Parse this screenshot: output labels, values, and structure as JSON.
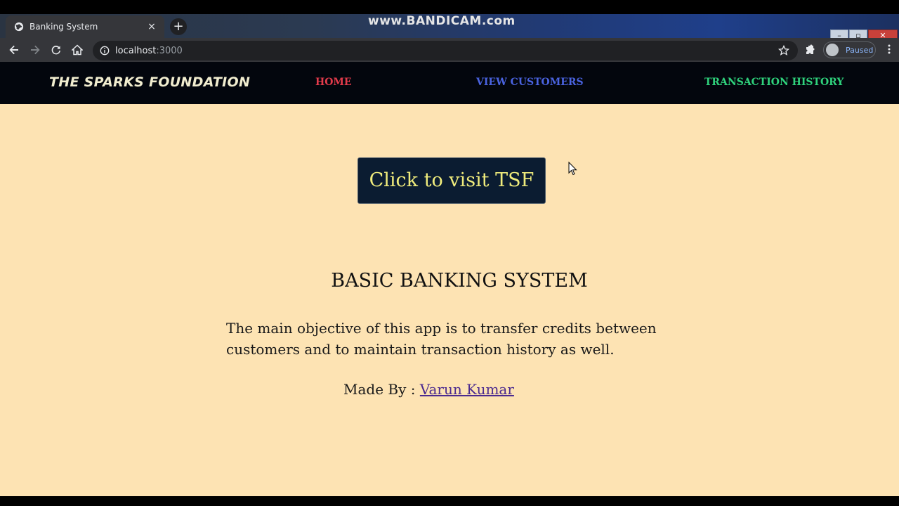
{
  "browser": {
    "tab_title": "Banking System",
    "tab_close": "×",
    "new_tab": "+",
    "watermark": "www.BANDICAM.com",
    "url_host": "localhost",
    "url_port": ":3000",
    "profile_status": "Paused",
    "window_controls": {
      "minimize": "–",
      "maximize": "▫",
      "close": "✕"
    }
  },
  "navbar": {
    "brand": "THE SPARKS FOUNDATION",
    "links": [
      {
        "label": "HOME",
        "color": "#e23b4b"
      },
      {
        "label": "VIEW CUSTOMERS",
        "color": "#4a63e0"
      },
      {
        "label": "TRANSACTION HISTORY",
        "color": "#2fd27c"
      }
    ]
  },
  "main": {
    "visit_button": "Click to visit TSF",
    "heading": "BASIC BANKING SYSTEM",
    "description": "The main objective of this app is to transfer credits between customers and to maintain transaction history as well.",
    "made_by_label": "Made By : ",
    "author": "Varun Kumar"
  },
  "colors": {
    "page_background": "#fde3b3",
    "navbar_background": "#03060d",
    "button_background": "#0b1c31",
    "button_text": "#f0ec7c"
  }
}
